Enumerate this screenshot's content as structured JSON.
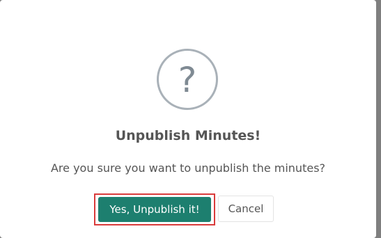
{
  "dialog": {
    "icon": "question-mark-icon",
    "icon_glyph": "?",
    "title": "Unpublish Minutes!",
    "message": "Are you sure you want to unpublish the minutes?",
    "confirm_label": "Yes, Unpublish it!",
    "cancel_label": "Cancel"
  },
  "colors": {
    "confirm_bg": "#1d7f6f",
    "highlight_border": "#d93b3b",
    "icon_ring": "#a9b1b8"
  }
}
